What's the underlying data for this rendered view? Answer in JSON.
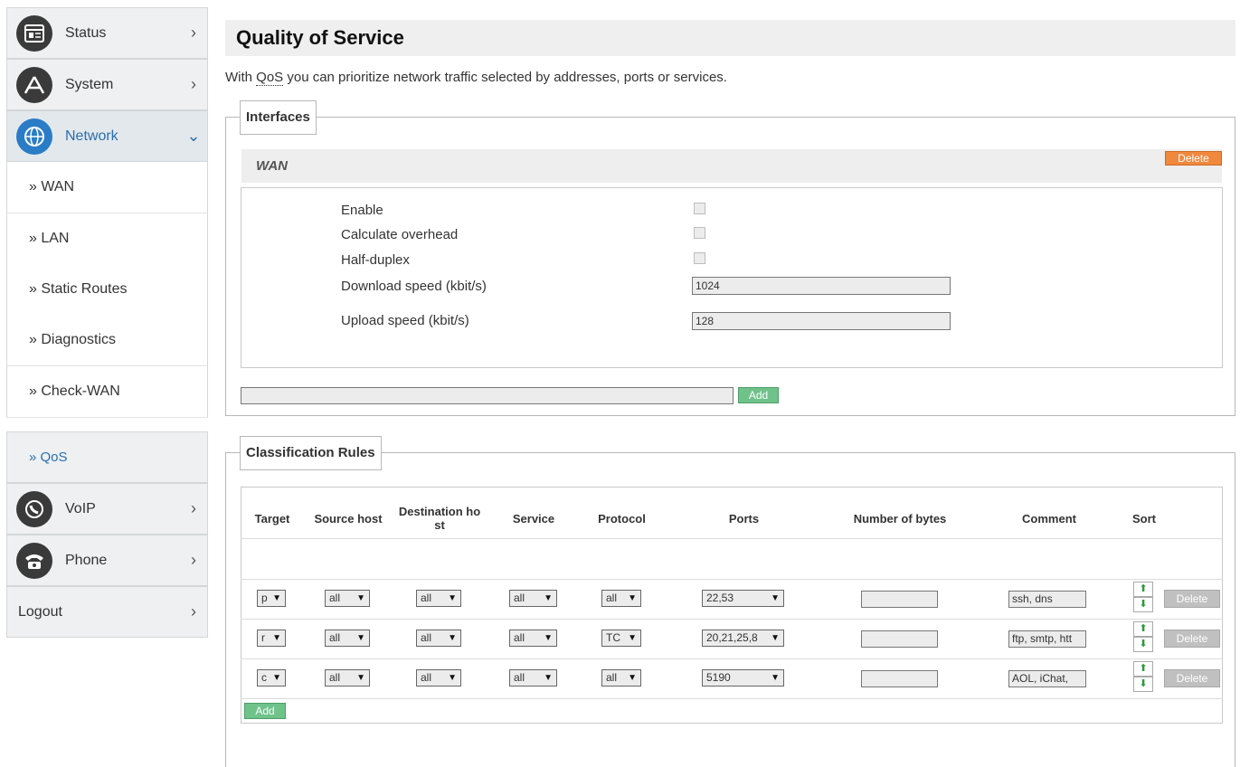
{
  "sidebar": {
    "status": "Status",
    "system": "System",
    "network": "Network",
    "network_items": [
      "» WAN",
      "» LAN",
      "» Static Routes",
      "» Diagnostics",
      "» Check-WAN"
    ],
    "qos": "» QoS",
    "voip": "VoIP",
    "phone": "Phone",
    "logout": "Logout",
    "chevron_right": "›",
    "chevron_down": "⌄"
  },
  "page": {
    "title": "Quality of Service",
    "intro_prefix": "With ",
    "intro_qos": "QoS",
    "intro_suffix": " you can prioritize network traffic selected by addresses, ports or services."
  },
  "interfaces": {
    "legend": "Interfaces",
    "wan_title": "WAN",
    "delete_label": "Delete",
    "enable_label": "Enable",
    "overhead_label": "Calculate overhead",
    "halfduplex_label": "Half-duplex",
    "download_label": "Download speed (kbit/s)",
    "download_value": "1024",
    "upload_label": "Upload speed (kbit/s)",
    "upload_value": "128",
    "add_label": "Add"
  },
  "rules": {
    "legend": "Classification Rules",
    "headers": [
      "Target",
      "Source host",
      "Destination ho st",
      "Service",
      "Protocol",
      "Ports",
      "Number of bytes",
      "Comment",
      "Sort"
    ],
    "rows": [
      {
        "target": "p",
        "source": "all",
        "dest": "all",
        "service": "all",
        "protocol": "all",
        "ports": "22,53",
        "bytes": "",
        "comment": "ssh, dns"
      },
      {
        "target": "r",
        "source": "all",
        "dest": "all",
        "service": "all",
        "protocol": "TC",
        "ports": "20,21,25,8",
        "bytes": "",
        "comment": "ftp, smtp, htt"
      },
      {
        "target": "c",
        "source": "all",
        "dest": "all",
        "service": "all",
        "protocol": "all",
        "ports": "5190",
        "bytes": "",
        "comment": "AOL, iChat,"
      }
    ],
    "delete_label": "Delete",
    "add_label": "Add"
  },
  "colors": {
    "accent_blue": "#2a7cc7",
    "delete_orange": "#f0883e",
    "add_green": "#6fc28a"
  },
  "icons": [
    "status-icon",
    "system-icon",
    "network-icon",
    "voip-icon",
    "phone-icon"
  ]
}
